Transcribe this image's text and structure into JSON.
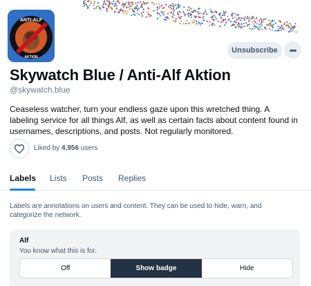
{
  "profile": {
    "avatar_text_top": "ANTI-ALF",
    "avatar_text_bottom": "AKTION",
    "title": "Skywatch Blue / Anti-Alf Aktion",
    "handle": "@skywatch.blue",
    "description": "Ceaseless watcher, turn your endless gaze upon this wretched thing. A labeling service for all things Alf, as well as certain facts about content found in usernames, descriptions, and posts. Not regularly monitored."
  },
  "actions": {
    "unsubscribe_label": "Unsubscribe",
    "more_label": "•••",
    "more_icon": "ellipsis-icon"
  },
  "likes": {
    "prefix": "Liked by",
    "count": "4,956",
    "suffix": "users",
    "icon": "heart-icon"
  },
  "tabs": [
    {
      "label": "Labels",
      "active": true
    },
    {
      "label": "Lists",
      "active": false
    },
    {
      "label": "Posts",
      "active": false
    },
    {
      "label": "Replies",
      "active": false
    }
  ],
  "labels_info": "Labels are annotations on users and content. They can be used to hide, warn, and categorize the network.",
  "label_card": {
    "name": "Alf",
    "description": "You know what this is for.",
    "options": [
      "Off",
      "Show badge",
      "Hide"
    ],
    "selected": "Show badge"
  },
  "colors": {
    "accent": "#1083fe",
    "selected_segment": "#233244",
    "muted_text": "#42566f"
  }
}
